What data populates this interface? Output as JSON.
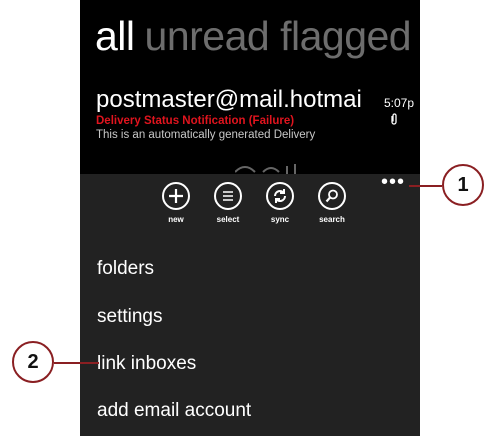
{
  "pivot": {
    "active": "all",
    "inactive": "unread flagged"
  },
  "message": {
    "from": "postmaster@mail.hotmail.com",
    "time": "5:07p",
    "subject": "Delivery Status Notification (Failure)",
    "preview": "This is an automatically generated Delivery"
  },
  "appbar": {
    "more": "•••",
    "buttons": [
      {
        "label": "new",
        "icon": "plus-icon"
      },
      {
        "label": "select",
        "icon": "list-icon"
      },
      {
        "label": "sync",
        "icon": "sync-icon"
      },
      {
        "label": "search",
        "icon": "search-icon"
      }
    ],
    "menu": [
      "folders",
      "settings",
      "link inboxes",
      "add email account"
    ]
  },
  "callouts": [
    "1",
    "2"
  ],
  "colors": {
    "callout_border": "#8a1f22",
    "subject_red": "#e0141e",
    "appbar_bg": "#222222"
  }
}
